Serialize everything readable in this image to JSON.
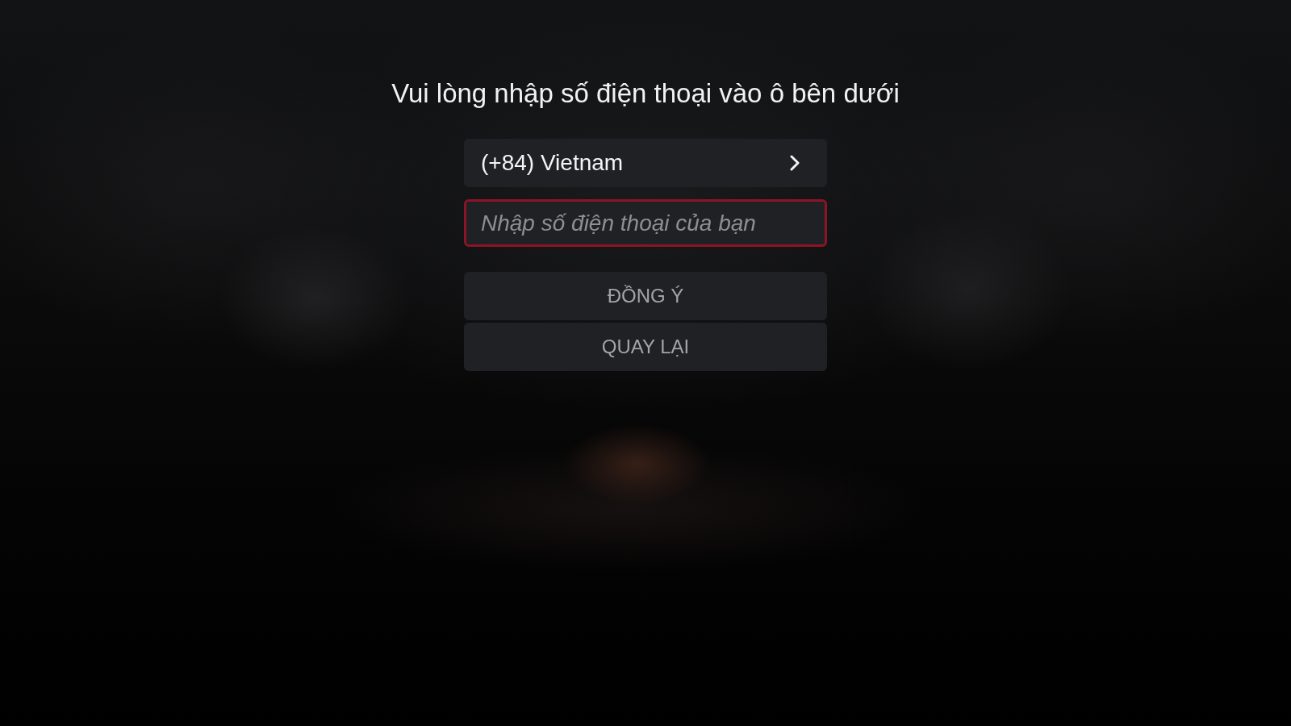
{
  "title": "Vui lòng nhập số điện thoại vào ô bên dưới",
  "country_selector": {
    "value": "(+84) Vietnam"
  },
  "phone_field": {
    "placeholder": "Nhập số điện thoại của bạn",
    "focused": true
  },
  "buttons": [
    {
      "label": "ĐỒNG Ý"
    },
    {
      "label": "QUAY LẠI"
    }
  ]
}
